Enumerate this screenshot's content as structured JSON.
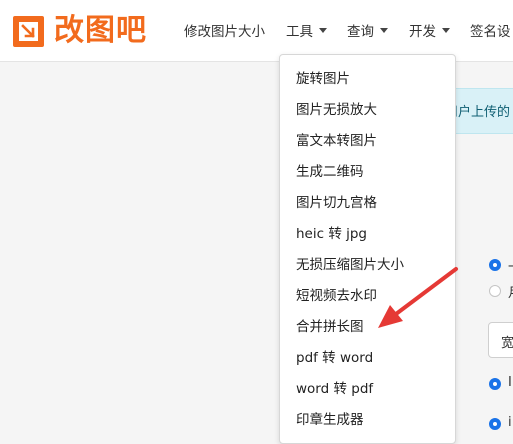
{
  "brand": {
    "name": "改图吧",
    "color": "#f26b1d"
  },
  "nav": {
    "resize": "修改图片大小",
    "tools": "工具",
    "query": "查询",
    "develop": "开发",
    "signature": "签名设"
  },
  "alert": {
    "text": "用户上传的"
  },
  "dropdown": {
    "items": [
      "旋转图片",
      "图片无损放大",
      "富文本转图片",
      "生成二维码",
      "图片切九宫格",
      "heic 转 jpg",
      "无损压缩图片大小",
      "短视频去水印",
      "合并拼长图",
      "pdf 转 word",
      "word 转 pdf",
      "印章生成器"
    ]
  },
  "background": {
    "option_peek_1": "一",
    "option_peek_2": "月",
    "button_peek": "宽",
    "option_peek_3": "I",
    "option_peek_4": "i"
  },
  "colors": {
    "accent": "#1a73e8",
    "arrow": "#e53935"
  }
}
